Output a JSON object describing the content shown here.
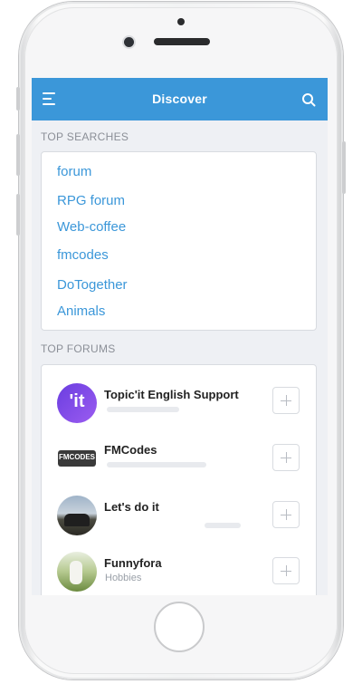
{
  "header": {
    "title": "Discover",
    "menu_icon": "hamburger-menu-icon",
    "search_icon": "search-icon",
    "color": "#3b97d9"
  },
  "top_searches": {
    "label": "TOP SEARCHES",
    "items": [
      "forum",
      "RPG forum",
      "Web-coffee",
      "fmcodes",
      "DoTogether",
      "Animals"
    ]
  },
  "top_forums": {
    "label": "TOP FORUMS",
    "items": [
      {
        "name": "Topic'it English Support",
        "subtitle": "",
        "avatar": "topicit-logo"
      },
      {
        "name": "FMCodes",
        "subtitle": "",
        "avatar": "fmcodes-logo"
      },
      {
        "name": "Let's do it",
        "subtitle": "",
        "avatar": "group-photo"
      },
      {
        "name": "Funnyfora",
        "subtitle": "Hobbies",
        "avatar": "outdoor-photo"
      }
    ],
    "avatar_text": {
      "topicit": "'it",
      "fmcodes": "FMCODES"
    }
  }
}
